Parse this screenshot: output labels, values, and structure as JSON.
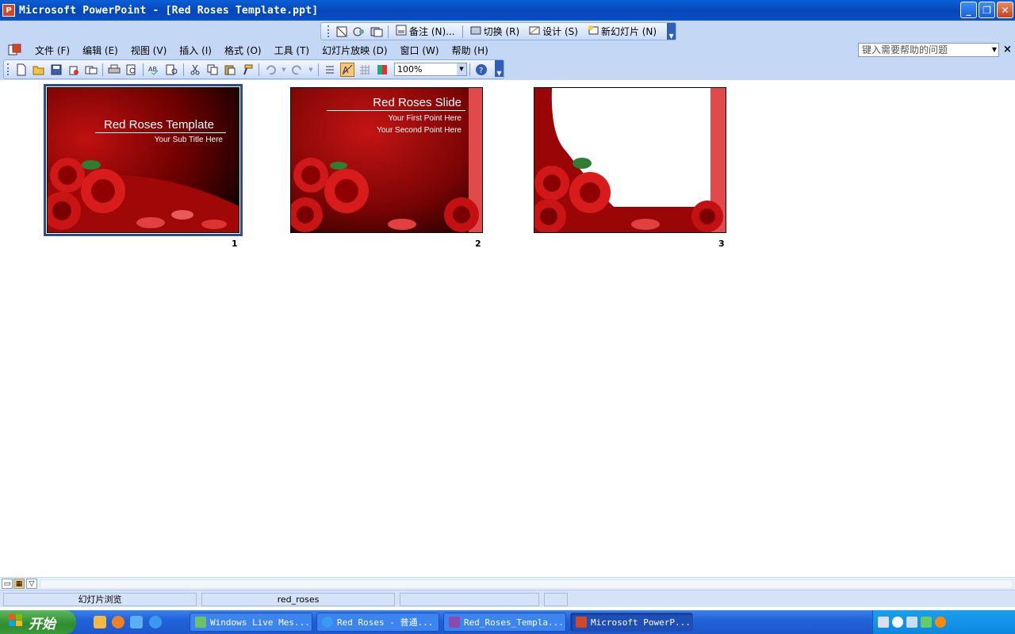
{
  "window": {
    "title": "Microsoft PowerPoint - [Red Roses Template.ppt]",
    "app_icon": "P"
  },
  "slide_sorter_toolbar": {
    "notes_label": "备注 (N)...",
    "transition_label": "切换 (R)",
    "design_label": "设计 (S)",
    "new_slide_label": "新幻灯片 (N)"
  },
  "menu": {
    "items": [
      "文件 (F)",
      "编辑 (E)",
      "视图 (V)",
      "插入 (I)",
      "格式 (O)",
      "工具 (T)",
      "幻灯片放映 (D)",
      "窗口 (W)",
      "帮助 (H)"
    ]
  },
  "help": {
    "placeholder": "键入需要帮助的问题"
  },
  "standard_toolbar": {
    "zoom": "100%"
  },
  "slides": [
    {
      "number": "1",
      "title": "Red Roses Template",
      "subtitle": "Your Sub Title Here"
    },
    {
      "number": "2",
      "title": "Red Roses Slide",
      "point1": "Your First Point Here",
      "point2": "Your Second Point Here"
    },
    {
      "number": "3"
    }
  ],
  "status": {
    "view_name": "幻灯片浏览",
    "template": "red_roses"
  },
  "taskbar": {
    "start": "开始",
    "tasks": [
      "Windows Live Mes...",
      "Red Roses - 普通...",
      "Red_Roses_Templa...",
      "Microsoft PowerP..."
    ]
  },
  "colors": {
    "titlebar": "#0a50c8",
    "accent_red": "#b00000"
  }
}
